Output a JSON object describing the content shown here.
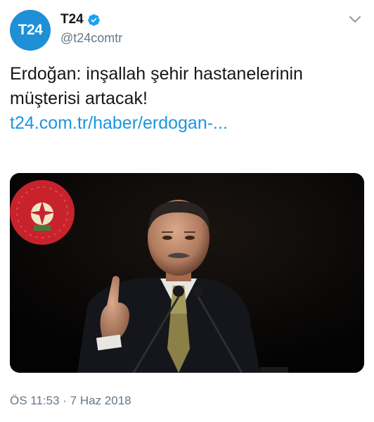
{
  "tweet": {
    "avatar_text": "T24",
    "display_name": "T24",
    "verified": true,
    "handle": "@t24comtr",
    "text": "Erdoğan: inşallah şehir hastanelerinin müşterisi artacak!",
    "link": "t24.com.tr/haber/erdogan-...",
    "timestamp": "ÖS 11:53 · 7 Haz 2018",
    "media": {
      "description_icon": "photo-media"
    }
  },
  "colors": {
    "brand_blue": "#1f8fd6",
    "link_blue": "#1b95e0",
    "verified_blue": "#1da1f2",
    "secondary_gray": "#657786",
    "text_dark": "#14171a"
  }
}
